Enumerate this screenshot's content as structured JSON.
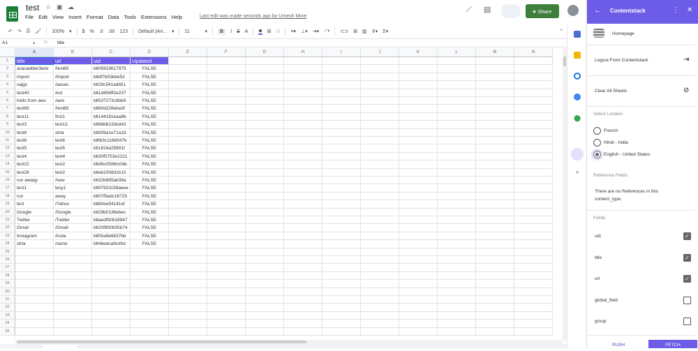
{
  "app": {
    "title": "test",
    "menus": [
      "File",
      "Edit",
      "View",
      "Insert",
      "Format",
      "Data",
      "Tools",
      "Extensions",
      "Help"
    ],
    "last_edit": "Last edit was made seconds ago by Umesh More",
    "share_label": "Share"
  },
  "toolbar": {
    "zoom": "100%",
    "currency": "$",
    "percent": "%",
    "dec_less": ".0",
    "dec_more": ".00",
    "format": "123",
    "font": "Default (Ari...",
    "size": "11",
    "bold": "B",
    "italic": "I",
    "strike": "S",
    "text_color": "A"
  },
  "formula": {
    "cell_ref": "A1",
    "fx": "fx",
    "value": "title"
  },
  "columns": [
    "A",
    "B",
    "C",
    "D",
    "E",
    "F",
    "G",
    "H",
    "I",
    "J",
    "K",
    "L",
    "M",
    "N"
  ],
  "header_row": [
    "title",
    "url",
    "uid",
    "Updated"
  ],
  "rows": [
    [
      "asasaddwr3wre",
      "/test65",
      "blt05919617975",
      "FALSE"
    ],
    [
      "import",
      "/import",
      "bltdf7b53bbe52",
      "FALSE"
    ],
    [
      "sajgs",
      "/aasas",
      "blt28c541adb51",
      "FALSE"
    ],
    [
      "test40",
      "/est",
      "blt1d456ff2e237",
      "FALSE"
    ],
    [
      "hello from aws",
      "/aws",
      "blt537273c9bb9",
      "FALSE"
    ],
    [
      "test65",
      "/test65",
      "blt80d226eba3f",
      "FALSE"
    ],
    [
      "test11",
      "first1",
      "blt144181eaa9b",
      "FALSE"
    ],
    [
      "test3",
      "test13",
      "blt8bb8133ed43",
      "FALSE"
    ],
    [
      "test8",
      "strta",
      "blt839a1e71a18",
      "FALSE"
    ],
    [
      "test6",
      "test6",
      "bltfb3c1166547b",
      "FALSE"
    ],
    [
      "test5",
      "test5",
      "blt1816a25891f",
      "FALSE"
    ],
    [
      "test4",
      "test4",
      "blt30f5753e2221",
      "FALSE"
    ],
    [
      "test22",
      "test2",
      "bltdfec5566c0db",
      "FALSE"
    ],
    [
      "test28",
      "test2",
      "blteb1008d1b15",
      "FALSE"
    ],
    [
      "run awaqy",
      "/new",
      "blt32b685ab39a",
      "FALSE"
    ],
    [
      "test1",
      "tesy1",
      "blt97922c59aeee",
      "FALSE"
    ],
    [
      "run",
      "away",
      "blt07f9adc16725",
      "FALSE"
    ],
    [
      "test",
      "/Yahoo",
      "blt80ee54141ef",
      "FALSE"
    ],
    [
      "Google",
      "/Google",
      "blt29b0136ebec",
      "FALSE"
    ],
    [
      "Twitter",
      "/Twitter",
      "bltaedf50618947",
      "FALSE"
    ],
    [
      "Gmail",
      "/Gmail",
      "blt20f900835b74",
      "FALSE"
    ],
    [
      "Instagram",
      "/insta",
      "blt55a9e6837bb",
      "FALSE"
    ],
    [
      "strta",
      "/same",
      "blt4bedca9cd0d",
      "FALSE"
    ]
  ],
  "total_rows": 35,
  "panel": {
    "title": "Contentstack",
    "content_type": "Homepage",
    "logout": "Logout From Contentstack",
    "clear": "Clear All Sheets",
    "locales_label": "Select Locales",
    "locales": [
      {
        "label": "French",
        "selected": false
      },
      {
        "label": "Hindi - India",
        "selected": false
      },
      {
        "label": "English - United States",
        "selected": true
      }
    ],
    "ref_label": "Reference Fields",
    "ref_text": "There are no References in this content_type.",
    "fields_label": "Fields",
    "fields": [
      {
        "label": "uid",
        "checked": true
      },
      {
        "label": "title",
        "checked": true
      },
      {
        "label": "url",
        "checked": true
      },
      {
        "label": "global_field",
        "checked": false
      },
      {
        "label": "group",
        "checked": false
      }
    ],
    "push": "PUSH",
    "fetch": "FETCH"
  },
  "colors": {
    "accent": "#6c5ce7",
    "share": "#3d7f3b"
  }
}
